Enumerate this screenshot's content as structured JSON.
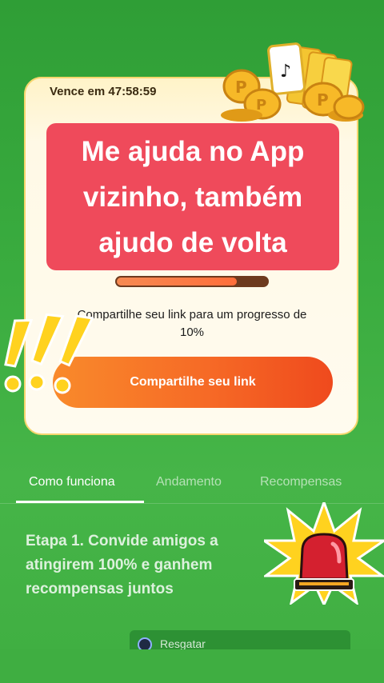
{
  "card": {
    "timer": "Vence em 47:58:59",
    "banner_text": "Me ajuda no App vizinho, também ajudo de volta",
    "progress": 0.8,
    "share_hint": "Compartilhe seu link para um progresso de 10%",
    "share_button": "Compartilhe seu link"
  },
  "tabs": [
    {
      "label": "Como funciona",
      "active": true
    },
    {
      "label": "Andamento",
      "active": false
    },
    {
      "label": "Recompensas",
      "active": false
    }
  ],
  "step": {
    "text": "Etapa 1. Convide amigos a atingirem 100% e ganhem recompensas juntos"
  },
  "redeem": {
    "label": "Resgatar"
  },
  "colors": {
    "background": "#35a53c",
    "banner": "#ef4a5b",
    "button_start": "#f98a2b",
    "button_end": "#ef4a1d",
    "card_border": "#f6d66e"
  },
  "icons": [
    "coins-icon",
    "exclamation-icon",
    "siren-icon",
    "avatar-icon"
  ]
}
